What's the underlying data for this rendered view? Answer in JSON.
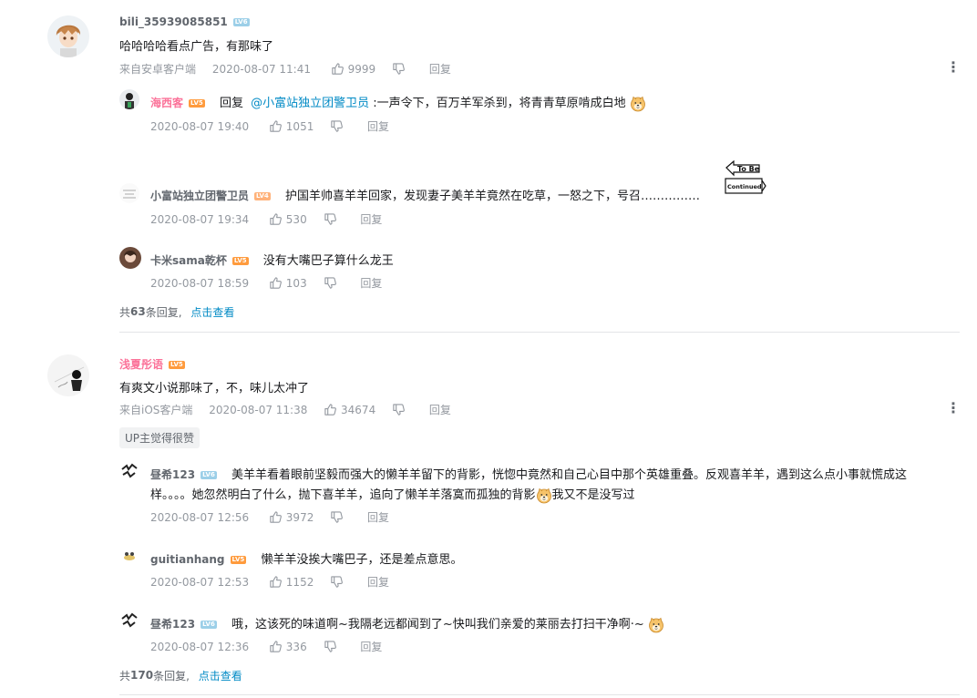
{
  "comments": [
    {
      "user": "bili_35939085851",
      "level": "LV6",
      "text": "哈哈哈哈看点广告，有那味了",
      "source": "来自安卓客户端",
      "time": "2020-08-07 11:41",
      "likes": "9999",
      "reply_label": "回复",
      "replies": [
        {
          "user": "海西客",
          "level": "LV5",
          "reply_prefix": "回复",
          "mention": "@小富站独立团警卫员",
          "text": " :一声令下，百万羊军杀到，将青青草原啃成白地",
          "time": "2020-08-07 19:40",
          "likes": "1051",
          "reply_label": "回复"
        },
        {
          "user": "小富站独立团警卫员",
          "level": "LV4",
          "text": "护国羊帅喜羊羊回家，发现妻子美羊羊竟然在吃草，一怒之下，号召……………",
          "sticker": "To Be Continued",
          "time": "2020-08-07 19:34",
          "likes": "530",
          "reply_label": "回复"
        },
        {
          "user": "卡米sama乾杯",
          "level": "LV5",
          "text": "没有大嘴巴子算什么龙王",
          "time": "2020-08-07 18:59",
          "likes": "103",
          "reply_label": "回复"
        }
      ],
      "reply_count_prefix": "共",
      "reply_count": "63",
      "reply_count_suffix": "条回复,",
      "view_more": "点击查看"
    },
    {
      "user": "浅夏彤语",
      "level": "LV5",
      "text": "有爽文小说那味了，不，味儿太冲了",
      "source": "来自iOS客户端",
      "time": "2020-08-07 11:38",
      "likes": "34674",
      "reply_label": "回复",
      "up_tag": "UP主觉得很赞",
      "replies": [
        {
          "user": "昼希123",
          "level": "LV6",
          "text_line1": "美羊羊看着眼前坚毅而强大的懒羊羊留下的背影，恍惚中竟然和自己心目中那个英雄重叠。反观喜羊羊，遇到这么点小事就慌成这",
          "text_line2": "样。。。。她忽然明白了什么，抛下喜羊羊，追向了懒羊羊落寞而孤独的背影",
          "text_tail": "我又不是没写过",
          "time": "2020-08-07 12:56",
          "likes": "3972",
          "reply_label": "回复"
        },
        {
          "user": "guitianhang",
          "level": "LV5",
          "text": "懒羊羊没挨大嘴巴子，还是差点意思。",
          "time": "2020-08-07 12:53",
          "likes": "1152",
          "reply_label": "回复"
        },
        {
          "user": "昼希123",
          "level": "LV6",
          "text": "哦，这该死的味道啊~我隔老远都闻到了~快叫我们亲爱的莱丽去打扫干净啊·~",
          "time": "2020-08-07 12:36",
          "likes": "336",
          "reply_label": "回复"
        }
      ],
      "reply_count_prefix": "共",
      "reply_count": "170",
      "reply_count_suffix": "条回复,",
      "view_more": "点击查看"
    }
  ],
  "colors": {
    "link": "#008ac5",
    "pink_name": "#fb7299",
    "meta": "#9499a0",
    "lv6": "#9ccfe8",
    "lv5": "#ff9b3d"
  },
  "icons": [
    "like-icon",
    "dislike-icon",
    "more-icon",
    "doge-emoji"
  ]
}
